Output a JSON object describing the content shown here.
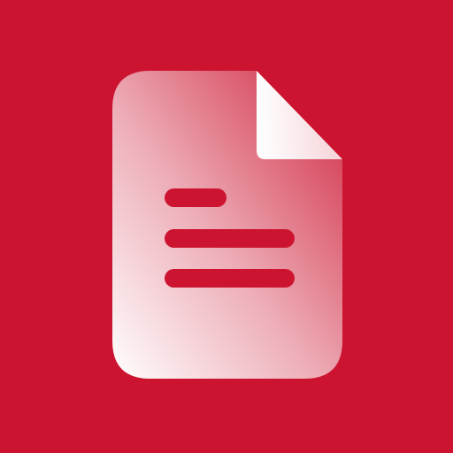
{
  "icon": {
    "name": "document-icon",
    "background_color": "#cc1430",
    "page_gradient_light": "#ffffff",
    "page_gradient_dark": "#cc1430",
    "line_color": "#cc1430",
    "text_lines": 3
  }
}
